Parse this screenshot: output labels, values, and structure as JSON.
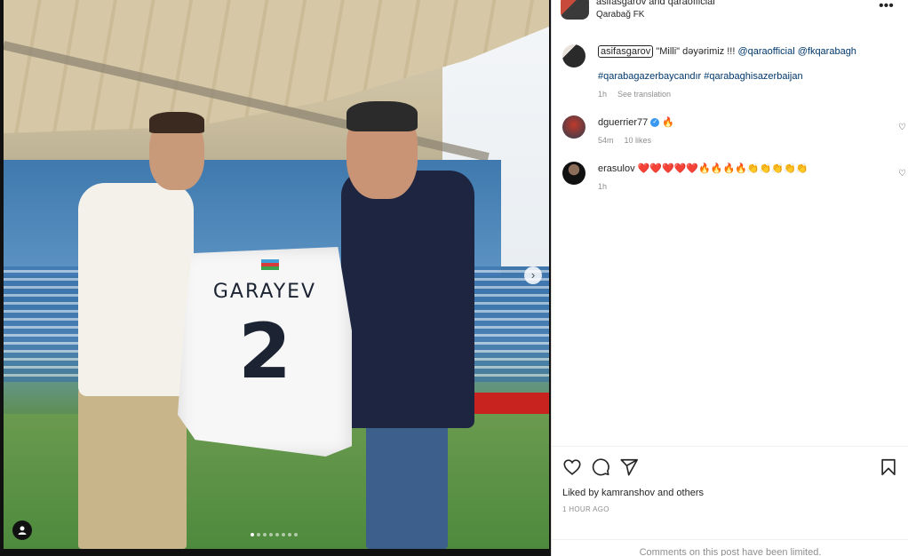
{
  "post": {
    "owner_line": "asifasgarov and qaraofficial",
    "location": "Qarabağ FK",
    "more_label": "•••"
  },
  "photo": {
    "jersey_name": "GARAYEV",
    "jersey_number": "2",
    "next_label": "›",
    "slide_count": 8,
    "active_slide": 1,
    "tag_icon": "person-tag-icon"
  },
  "caption": {
    "username": "asifasgarov",
    "text_before": "\"Milli\" dəyərimiz !!! ",
    "mention1": "@qaraofficial",
    "mention2": "@fkqarabagh",
    "hashtag1": "#qarabagazerbaycandır",
    "hashtag2": "#qarabaghisazerbaijan",
    "time": "1h",
    "see_translation": "See translation"
  },
  "comments": [
    {
      "username": "dguerrier77",
      "text": "🔥",
      "time": "54m",
      "likes": "10 likes",
      "verified": true
    },
    {
      "username": "erasulov",
      "text": "❤️❤️❤️❤️❤️🔥🔥🔥🔥👏👏👏👏👏",
      "time": "1h"
    }
  ],
  "footer": {
    "liked_by_prefix": "Liked by ",
    "liked_by_user": "kamranshov",
    "liked_by_suffix": " and ",
    "liked_by_others": "others",
    "time_ago": "1 HOUR AGO",
    "limited_notice": "Comments on this post have been limited."
  },
  "icons": [
    "heart-icon",
    "comment-icon",
    "share-icon",
    "bookmark-icon",
    "more-icon",
    "verified-icon",
    "chevron-right-icon"
  ]
}
